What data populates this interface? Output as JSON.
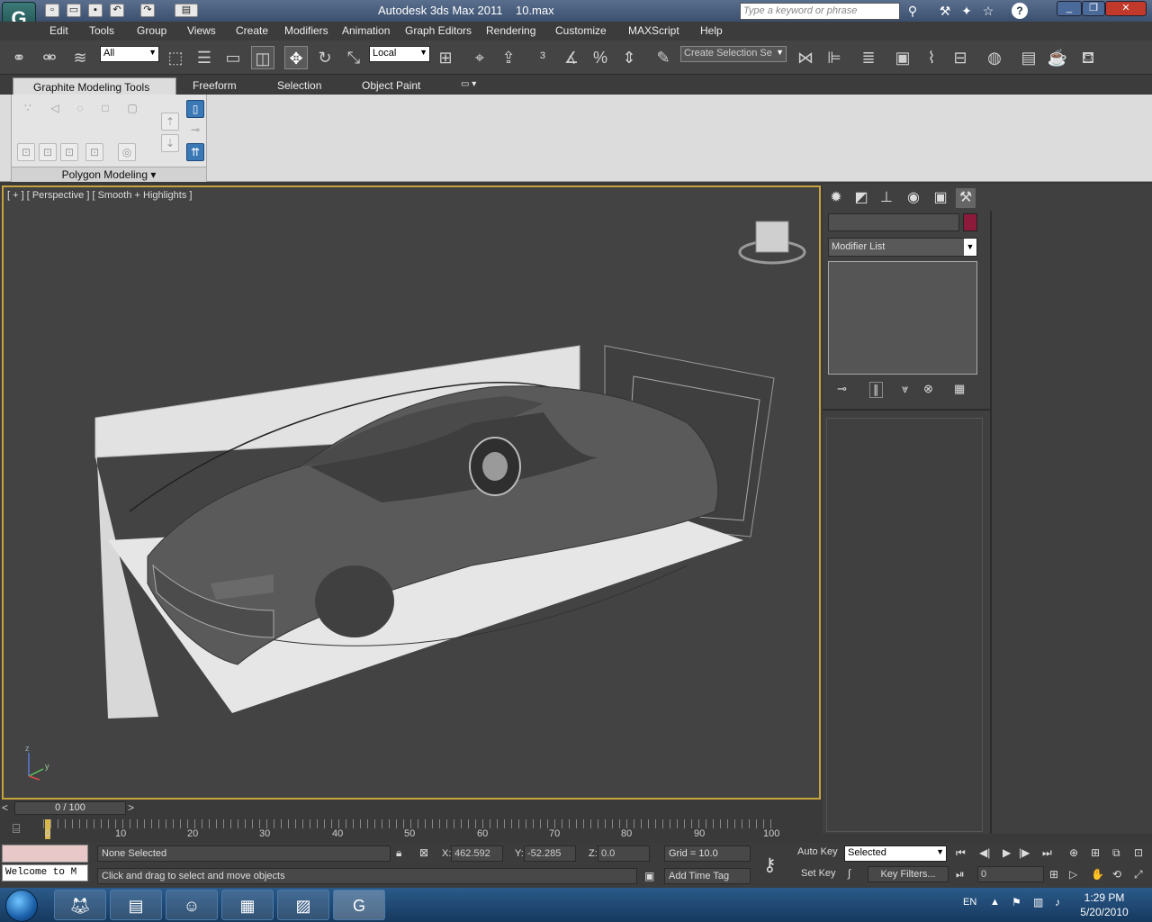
{
  "titlebar": {
    "app_title": "Autodesk 3ds Max  2011",
    "file_name": "10.max",
    "search_placeholder": "Type a keyword or phrase",
    "help_label": "?"
  },
  "menu": {
    "items": [
      "Edit",
      "Tools",
      "Group",
      "Views",
      "Create",
      "Modifiers",
      "Animation",
      "Graph Editors",
      "Rendering",
      "Customize",
      "MAXScript",
      "Help"
    ]
  },
  "toolbar": {
    "selection_filter": "All",
    "ref_coord": "Local",
    "named_selection": "Create Selection Se"
  },
  "ribbon": {
    "tabs": [
      "Graphite Modeling Tools",
      "Freeform",
      "Selection",
      "Object Paint"
    ],
    "panel_label": "Polygon Modeling"
  },
  "viewport": {
    "label": "[ + ] [ Perspective ] [ Smooth + Highlights ]",
    "axis_z": "z",
    "axis_y": "y"
  },
  "command_panel": {
    "modifier_list": "Modifier List",
    "object_color": "#8c1a3a"
  },
  "timeline": {
    "frame_display": "0 / 100",
    "ticks": [
      "0",
      "10",
      "20",
      "30",
      "40",
      "50",
      "60",
      "70",
      "80",
      "90",
      "100"
    ]
  },
  "status": {
    "maxscript_text": "Welcome to M",
    "selection_info": "None Selected",
    "prompt": "Click and drag to select and move objects",
    "x_label": "X:",
    "x_value": "462.592",
    "y_label": "Y:",
    "y_value": "-52.285",
    "z_label": "Z:",
    "z_value": "0.0",
    "grid": "Grid = 10.0",
    "add_time_tag": "Add Time Tag",
    "auto_key": "Auto Key",
    "set_key": "Set Key",
    "key_mode": "Selected",
    "key_filters": "Key Filters...",
    "current_frame": "0"
  },
  "taskbar": {
    "language": "EN",
    "time": "1:29 PM",
    "date": "5/20/2010"
  }
}
